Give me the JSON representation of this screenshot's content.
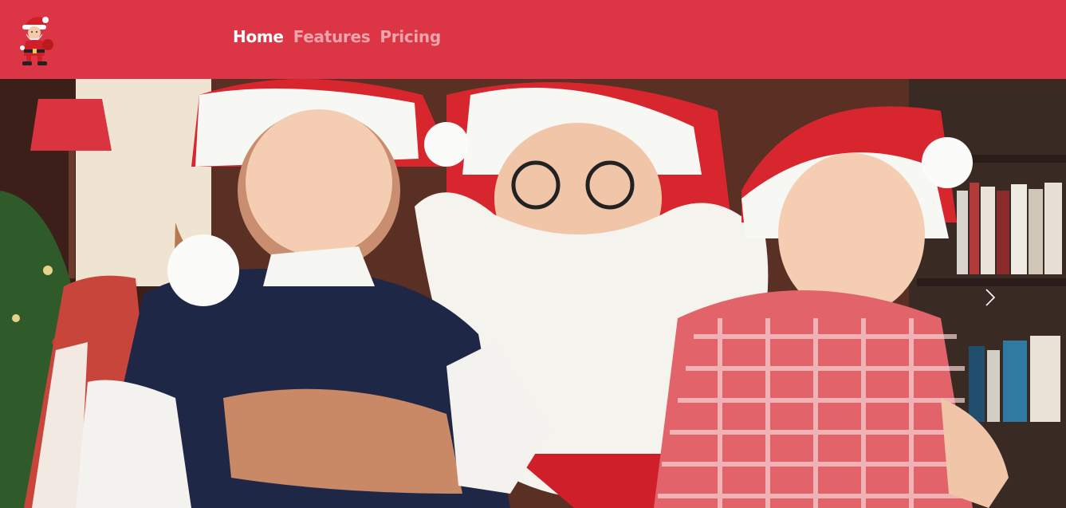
{
  "navbar": {
    "logo_icon": "santa-claus-icon",
    "brand_color": "#dc3545",
    "links": [
      {
        "label": "Home",
        "active": true
      },
      {
        "label": "Features",
        "active": false
      },
      {
        "label": "Pricing",
        "active": false
      }
    ]
  },
  "carousel": {
    "image": "photo of two smiling children in santa hats sitting on santa claus's lap",
    "next_icon": "chevron-right-icon"
  }
}
